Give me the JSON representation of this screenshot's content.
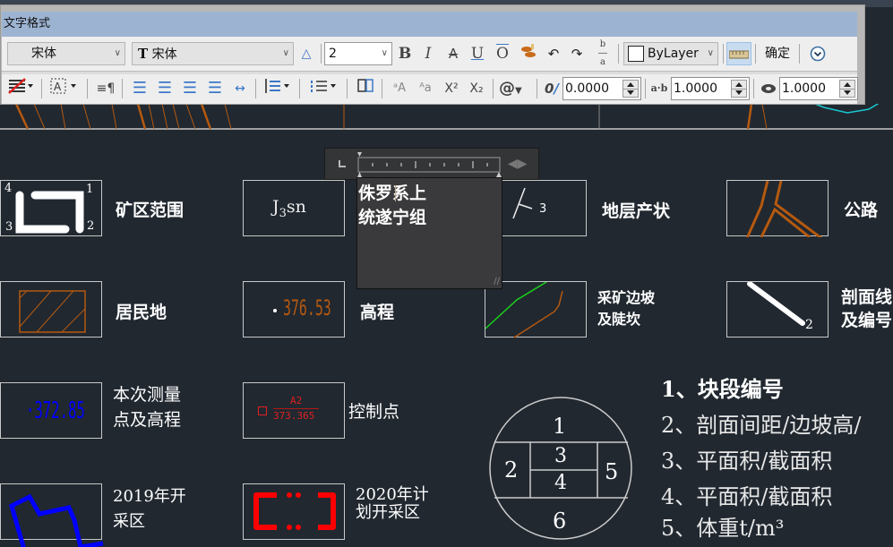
{
  "toolbar": {
    "title": "文字格式",
    "style_select": "宋体",
    "font_select": "宋体",
    "font_icon": "truetype-font-icon",
    "text_height": "2",
    "bold_label": "B",
    "italic_label": "I",
    "strike_label": "A",
    "underline_label": "U",
    "overline_label": "O",
    "color_select": "ByLayer",
    "ok_label": "确定",
    "oblique_angle": "0.0000",
    "tracking": "1.0000",
    "width_factor": "1.0000",
    "superscript_label": "X²",
    "subscript_label": "X₂",
    "symbol_label": "@"
  },
  "editor": {
    "line1": "侏罗系上",
    "line2": "统遂宁组"
  },
  "legend": {
    "mining_area": {
      "label": "矿区范围",
      "corners": [
        "4",
        "1",
        "3",
        "2"
      ]
    },
    "stratum_code": {
      "base": "J",
      "sub": "3",
      "suffix": "sn"
    },
    "attitude": {
      "label": "地层产状",
      "value": "3"
    },
    "road": {
      "label": "公路"
    },
    "residential": {
      "label": "居民地"
    },
    "elevation": {
      "label": "高程",
      "value": "376.53"
    },
    "slope": {
      "line1": "采矿边坡",
      "line2": "及陡坎"
    },
    "section": {
      "line1": "剖面线",
      "line2": "及编号",
      "value": "2"
    },
    "survey_point": {
      "line1": "本次测量",
      "line2": "点及高程",
      "value": "·372.85"
    },
    "control_point": {
      "label": "控制点",
      "name": "A2",
      "value": "373.365"
    },
    "mined_2019": {
      "line1": "2019年开",
      "line2": "采区"
    },
    "planned_2020": {
      "line1": "2020年计",
      "line2": "划开采区"
    }
  },
  "block_diagram": {
    "cells": [
      "1",
      "2",
      "3",
      "4",
      "5",
      "6"
    ],
    "notes": [
      "1、块段编号",
      "2、剖面间距/边坡高/",
      "3、平面积/截面积",
      "4、平面积/截面积",
      "5、体重t/m³"
    ]
  },
  "colors": {
    "canvas": "#212830",
    "orange": "#b5590f",
    "green": "#19d219",
    "blue": "#0000ff",
    "red": "#ff0000",
    "cyan": "#18c8d0"
  }
}
